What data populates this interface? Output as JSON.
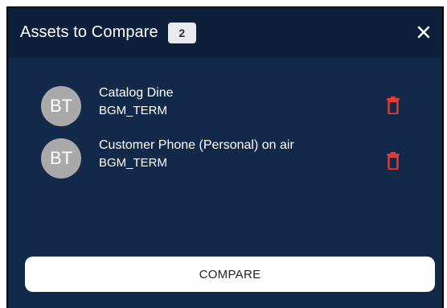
{
  "header": {
    "title": "Assets to Compare",
    "count": "2",
    "close_icon": "close-icon"
  },
  "assets": [
    {
      "avatar_initials": "BT",
      "name": "Catalog Dine",
      "type": "BGM_TERM",
      "delete_icon": "trash-icon"
    },
    {
      "avatar_initials": "BT",
      "name": "Customer Phone (Personal) on air",
      "type": "BGM_TERM",
      "delete_icon": "trash-icon"
    }
  ],
  "actions": {
    "compare_label": "COMPARE"
  },
  "colors": {
    "panel_background": "#13294a",
    "header_background": "#0d1f3b",
    "avatar": "#a9a9a9",
    "delete_icon": "#e53935",
    "badge": "#e9ebef"
  }
}
